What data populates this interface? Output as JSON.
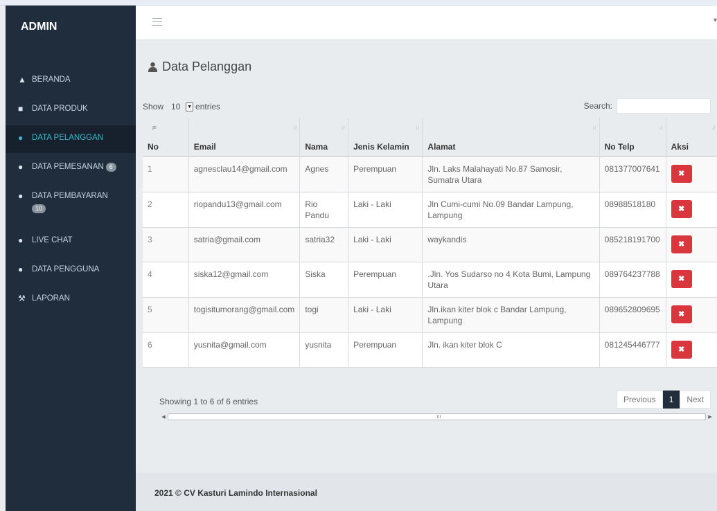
{
  "brand": "ADMIN",
  "sidebar": {
    "items": [
      {
        "label": "BERANDA",
        "icon": "home-icon",
        "glyph": "▲"
      },
      {
        "label": "DATA PRODUK",
        "icon": "file-icon",
        "glyph": "■"
      },
      {
        "label": "DATA PELANGGAN",
        "icon": "user-icon",
        "glyph": "●"
      },
      {
        "label": "DATA PEMESANAN",
        "icon": "user-icon",
        "glyph": "●",
        "badge": "6"
      },
      {
        "label": "DATA PEMBAYARAN",
        "icon": "user-icon",
        "glyph": "●",
        "badge": "10"
      },
      {
        "label": "LIVE CHAT",
        "icon": "user-icon",
        "glyph": "●"
      },
      {
        "label": "DATA PENGGUNA",
        "icon": "user-icon",
        "glyph": "●"
      },
      {
        "label": "LAPORAN",
        "icon": "tools-icon",
        "glyph": "⚒"
      }
    ],
    "active_index": 2
  },
  "page": {
    "title": "Data Pelanggan",
    "title_icon": "user-icon"
  },
  "table_controls": {
    "show_label": "Show",
    "entries_value": "10",
    "entries_label": "entries",
    "search_label": "Search:",
    "search_value": ""
  },
  "table": {
    "columns": [
      "No",
      "Email",
      "Nama",
      "Jenis Kelamin",
      "Alamat",
      "No Telp",
      "Aksi"
    ],
    "rows": [
      {
        "no": "1",
        "email": "agnesclau14@gmail.com",
        "nama": "Agnes",
        "jk": "Perempuan",
        "alamat": "Jln. Laks Malahayati No.87 Samosir, Sumatra Utara",
        "telp": "081377007641"
      },
      {
        "no": "2",
        "email": "riopandu13@gmail.com",
        "nama": "Rio Pandu",
        "jk": "Laki - Laki",
        "alamat": "Jln Cumi-cumi No.09 Bandar Lampung, Lampung",
        "telp": "08988518180"
      },
      {
        "no": "3",
        "email": "satria@gmail.com",
        "nama": "satria32",
        "jk": "Laki - Laki",
        "alamat": "waykandis",
        "telp": "085218191700"
      },
      {
        "no": "4",
        "email": "siska12@gmail.com",
        "nama": "Siska",
        "jk": "Perempuan",
        "alamat": ".Jln. Yos Sudarso no 4 Kota Bumi, Lampung Utara",
        "telp": "089764237788"
      },
      {
        "no": "5",
        "email": "togisitumorang@gmail.com",
        "nama": "togi",
        "jk": "Laki - Laki",
        "alamat": "Jln.ikan kiter blok c Bandar Lampung, Lampung",
        "telp": "089652809695"
      },
      {
        "no": "6",
        "email": "yusnita@gmail.com",
        "nama": "yusnita",
        "jk": "Perempuan",
        "alamat": "Jln. ikan kiter blok C",
        "telp": "081245446777"
      }
    ],
    "delete_glyph": "✖"
  },
  "info": "Showing 1 to 6 of 6 entries",
  "pagination": {
    "previous": "Previous",
    "current": "1",
    "next": "Next"
  },
  "footer": "2021 © CV Kasturi Lamindo Internasional",
  "colors": {
    "sidebar_bg": "#1f2d3d",
    "active_text": "#3fb5c9",
    "delete_button": "#d9363e"
  }
}
